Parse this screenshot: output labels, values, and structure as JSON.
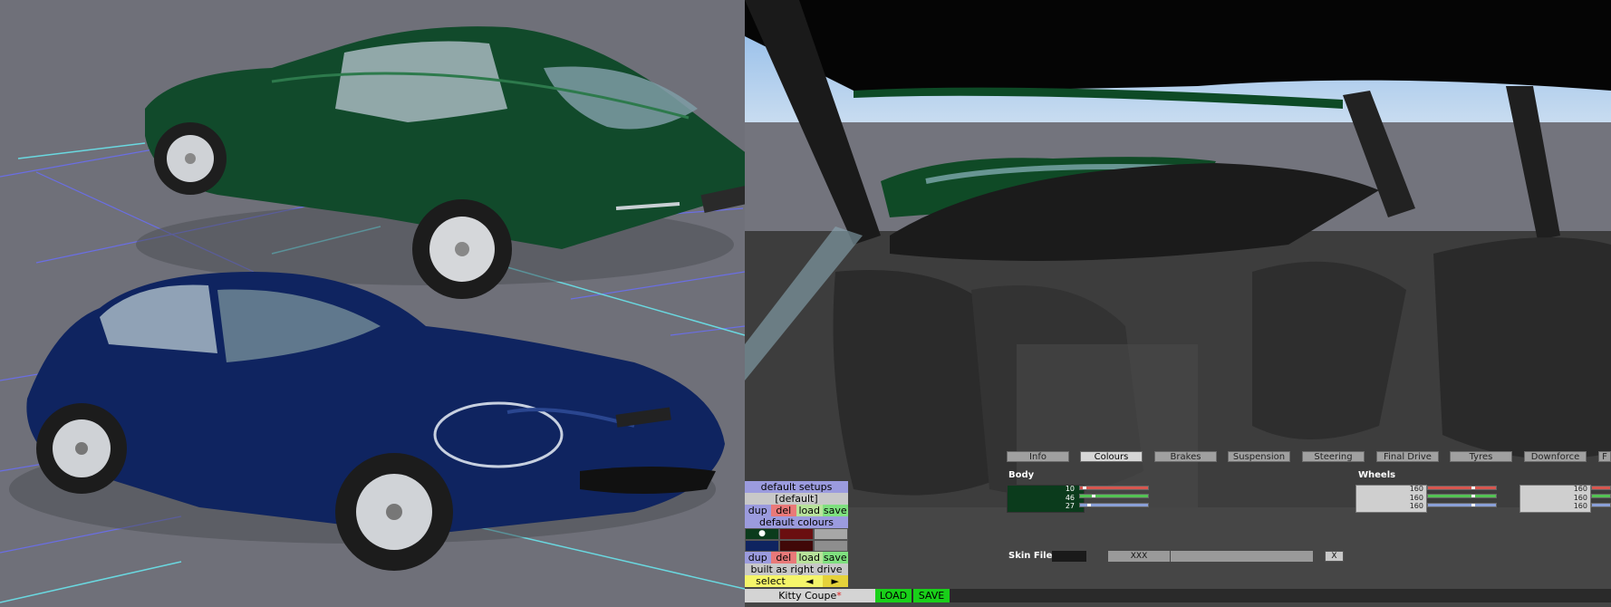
{
  "setups_panel": {
    "header_setups": "default setups",
    "setup_value": "[default]",
    "buttons1": {
      "dup": "dup",
      "del": "del",
      "load": "load",
      "save": "save"
    },
    "header_colours": "default colours",
    "buttons2": {
      "dup": "dup",
      "del": "del",
      "load": "load",
      "save": "save"
    },
    "drive_label": "built as right drive",
    "select_label": "select",
    "prev_icon": "◄",
    "next_icon": "►"
  },
  "bottom_bar": {
    "car_name": "Kitty Coupe",
    "modified_marker": "*",
    "load_label": "LOAD",
    "save_label": "SAVE"
  },
  "tabs": [
    "Info",
    "Colours",
    "Brakes",
    "Suspension",
    "Steering",
    "Final Drive",
    "Tyres",
    "Downforce",
    "F"
  ],
  "active_tab": "Colours",
  "body_colour": {
    "label": "Body",
    "r": "10",
    "g": "46",
    "b": "27",
    "r_level": 0.04,
    "g_level": 0.18,
    "b_level": 0.11,
    "swatch": "#0b3b1c"
  },
  "wheels_colour": {
    "label": "Wheels",
    "r": "160",
    "g": "160",
    "b": "160",
    "level": 0.63
  },
  "wheels_colour_2": {
    "r": "160",
    "g": "160",
    "b": "160"
  },
  "skin": {
    "label": "Skin File Name",
    "value": "XXX",
    "clear": "X"
  },
  "colors": {
    "ground": "#6f7079",
    "green_car": "#114a2b",
    "blue_car": "#0f2460",
    "grid_blue": "#6a6ef0",
    "grid_cyan": "#6ad8e0"
  }
}
